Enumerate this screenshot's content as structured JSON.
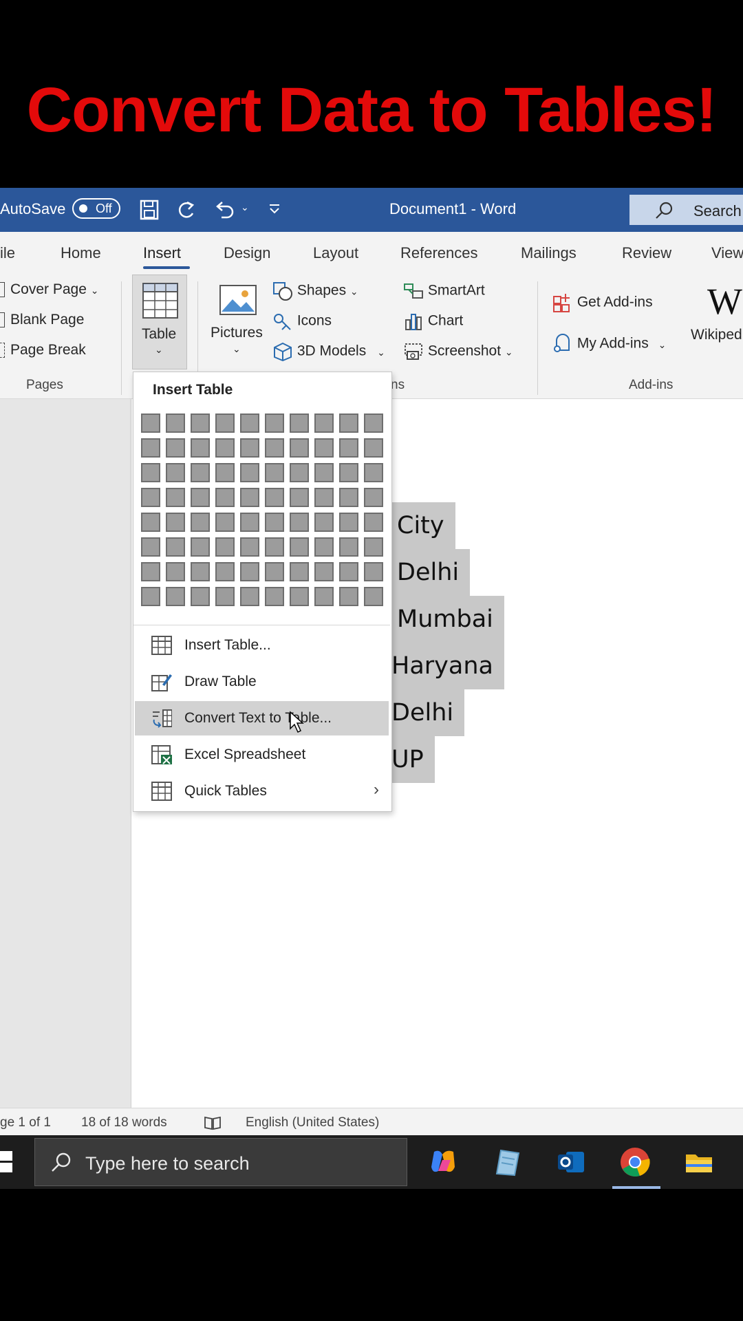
{
  "headline": "Convert Data to Tables!",
  "titlebar": {
    "autosave": "AutoSave",
    "autosave_state": "Off",
    "document_title": "Document1  -  Word",
    "search": "Search"
  },
  "tabs": [
    "ile",
    "Home",
    "Insert",
    "Design",
    "Layout",
    "References",
    "Mailings",
    "Review",
    "View"
  ],
  "ribbon": {
    "pages": [
      "Cover Page",
      "Blank Page",
      "Page Break"
    ],
    "pages_group": "Pages",
    "table": "Table",
    "pictures": "Pictures",
    "illustrations": [
      "Shapes",
      "Icons",
      "3D Models"
    ],
    "illustrations_col2": [
      "SmartArt",
      "Chart",
      "Screenshot"
    ],
    "illustrations_group": "ns",
    "addins": [
      "Get Add-ins",
      "My Add-ins"
    ],
    "addins_group": "Add-ins",
    "wikipedia": "Wikiped"
  },
  "dropdown": {
    "title": "Insert Table",
    "items": [
      {
        "label": "Insert Table...",
        "icon": "table-grid-icon"
      },
      {
        "label": "Draw Table",
        "icon": "draw-table-pencil-icon"
      },
      {
        "label": "Convert Text to Table...",
        "icon": "convert-text-table-icon"
      },
      {
        "label": "Excel Spreadsheet",
        "icon": "excel-spreadsheet-icon"
      },
      {
        "label": "Quick Tables",
        "icon": "quick-tables-icon"
      }
    ]
  },
  "document_cells": [
    "City",
    "Delhi",
    "Mumbai",
    "Haryana",
    "Delhi",
    "UP"
  ],
  "statusbar": {
    "page": "ge 1 of 1",
    "words": "18 of 18 words",
    "language": "English (United States)"
  },
  "taskbar": {
    "search_placeholder": "Type here to search"
  },
  "colors": {
    "headline": "#e30a0a",
    "word_blue": "#2b579a",
    "selection": "#c8c8c8"
  }
}
